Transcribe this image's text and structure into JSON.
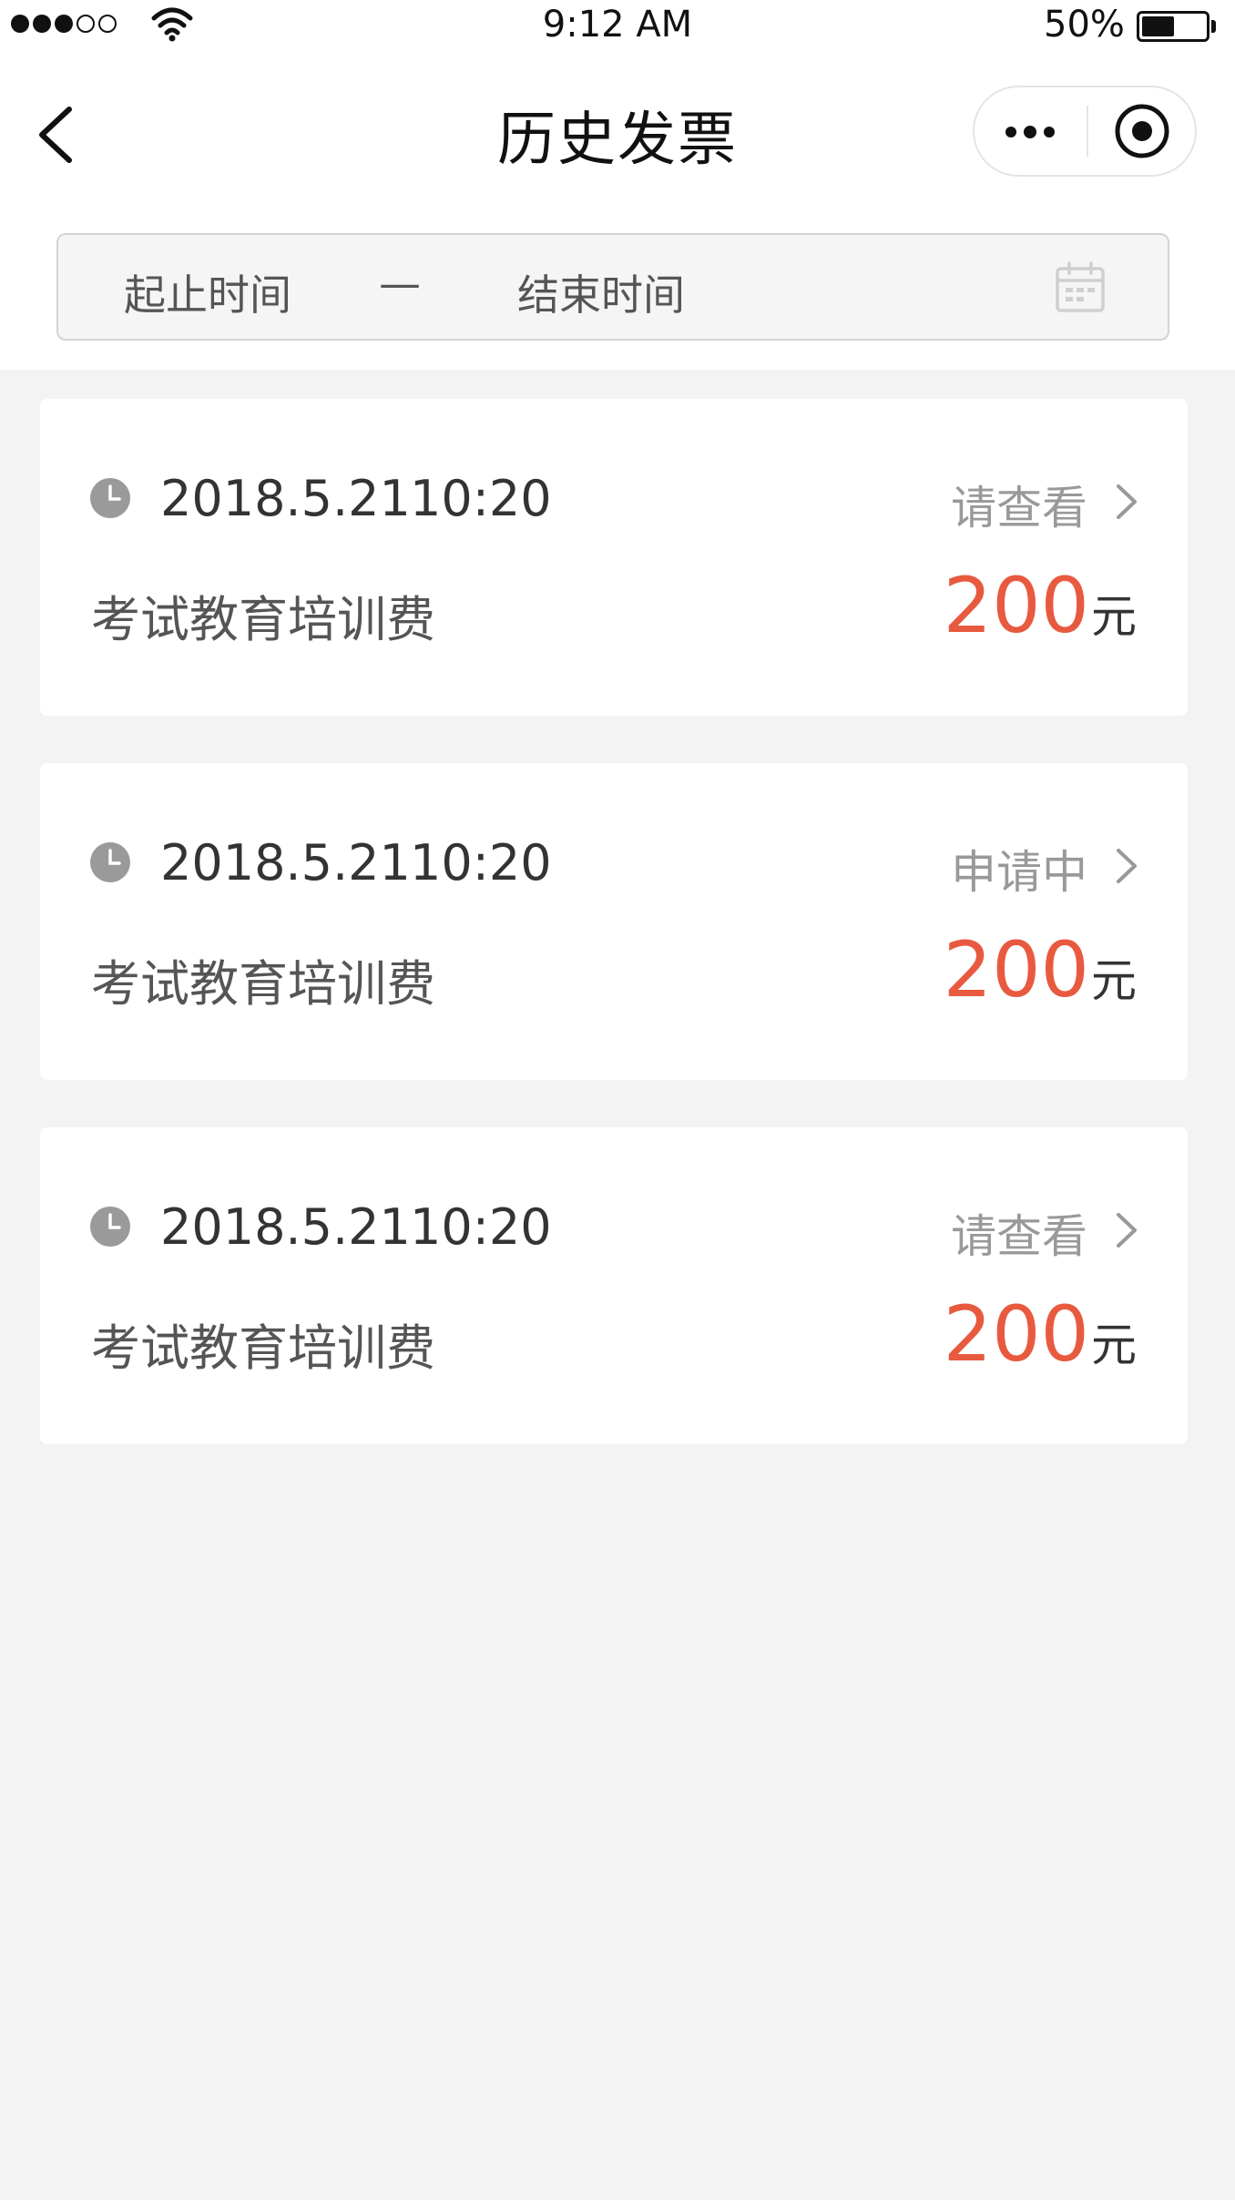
{
  "status_bar": {
    "time": "9:12 AM",
    "battery_percent": "50%",
    "battery_level": 0.5,
    "signal_bars_filled": 3,
    "signal_bars_total": 5
  },
  "nav": {
    "title": "历史发票",
    "back_icon": "chevron-left-icon",
    "more_icon": "more-dots-icon",
    "close_icon": "target-circle-icon"
  },
  "filter": {
    "start_label": "起止时间",
    "separator": "—",
    "end_label": "结束时间",
    "icon": "calendar-icon"
  },
  "invoices": [
    {
      "date": "2018.5.21",
      "time": "10:20",
      "status": "请查看",
      "description": "考试教育培训费",
      "amount": "200",
      "unit": "元"
    },
    {
      "date": "2018.5.21",
      "time": "10:20",
      "status": "申请中",
      "description": "考试教育培训费",
      "amount": "200",
      "unit": "元"
    },
    {
      "date": "2018.5.21",
      "time": "10:20",
      "status": "请查看",
      "description": "考试教育培训费",
      "amount": "200",
      "unit": "元"
    }
  ],
  "colors": {
    "accent_amount": "#e85a3f",
    "background": "#f3f3f3",
    "card": "#ffffff",
    "muted_text": "#999999"
  }
}
